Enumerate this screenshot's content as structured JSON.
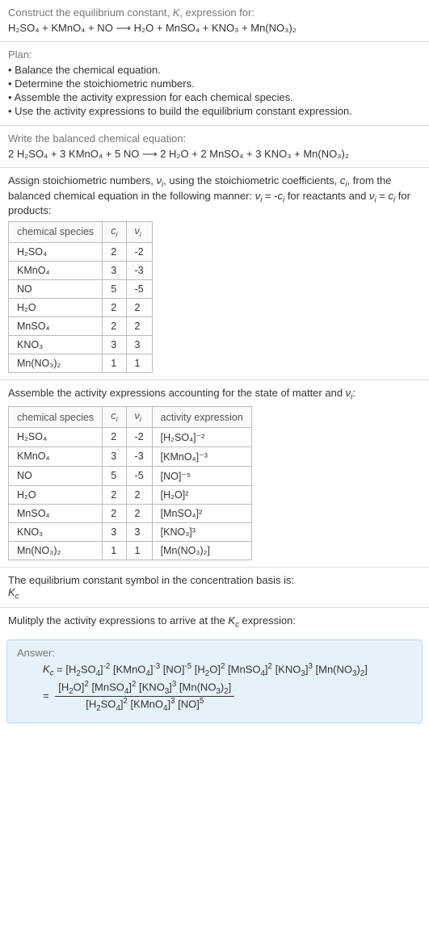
{
  "intro": {
    "line1": "Construct the equilibrium constant, K, expression for:",
    "equation": "H₂SO₄ + KMnO₄ + NO ⟶ H₂O + MnSO₄ + KNO₃ + Mn(NO₃)₂"
  },
  "plan": {
    "heading": "Plan:",
    "items": [
      "Balance the chemical equation.",
      "Determine the stoichiometric numbers.",
      "Assemble the activity expression for each chemical species.",
      "Use the activity expressions to build the equilibrium constant expression."
    ]
  },
  "balanced": {
    "heading": "Write the balanced chemical equation:",
    "equation": "2 H₂SO₄ + 3 KMnO₄ + 5 NO ⟶ 2 H₂O + 2 MnSO₄ + 3 KNO₃ + Mn(NO₃)₂"
  },
  "stoich": {
    "heading": "Assign stoichiometric numbers, νᵢ, using the stoichiometric coefficients, cᵢ, from the balanced chemical equation in the following manner: νᵢ = -cᵢ for reactants and νᵢ = cᵢ for products:",
    "headers": {
      "species": "chemical species",
      "c": "cᵢ",
      "v": "νᵢ"
    },
    "rows": [
      {
        "species": "H₂SO₄",
        "c": "2",
        "v": "-2"
      },
      {
        "species": "KMnO₄",
        "c": "3",
        "v": "-3"
      },
      {
        "species": "NO",
        "c": "5",
        "v": "-5"
      },
      {
        "species": "H₂O",
        "c": "2",
        "v": "2"
      },
      {
        "species": "MnSO₄",
        "c": "2",
        "v": "2"
      },
      {
        "species": "KNO₃",
        "c": "3",
        "v": "3"
      },
      {
        "species": "Mn(NO₃)₂",
        "c": "1",
        "v": "1"
      }
    ]
  },
  "activity": {
    "heading": "Assemble the activity expressions accounting for the state of matter and νᵢ:",
    "headers": {
      "species": "chemical species",
      "c": "cᵢ",
      "v": "νᵢ",
      "expr": "activity expression"
    },
    "rows": [
      {
        "species": "H₂SO₄",
        "c": "2",
        "v": "-2",
        "expr": "[H₂SO₄]⁻²"
      },
      {
        "species": "KMnO₄",
        "c": "3",
        "v": "-3",
        "expr": "[KMnO₄]⁻³"
      },
      {
        "species": "NO",
        "c": "5",
        "v": "-5",
        "expr": "[NO]⁻⁵"
      },
      {
        "species": "H₂O",
        "c": "2",
        "v": "2",
        "expr": "[H₂O]²"
      },
      {
        "species": "MnSO₄",
        "c": "2",
        "v": "2",
        "expr": "[MnSO₄]²"
      },
      {
        "species": "KNO₃",
        "c": "3",
        "v": "3",
        "expr": "[KNO₃]³"
      },
      {
        "species": "Mn(NO₃)₂",
        "c": "1",
        "v": "1",
        "expr": "[Mn(NO₃)₂]"
      }
    ]
  },
  "kc_symbol": {
    "line1": "The equilibrium constant symbol in the concentration basis is:",
    "line2": "K𝒸"
  },
  "multiply": {
    "heading": "Mulitply the activity expressions to arrive at the K𝒸 expression:"
  },
  "answer": {
    "label": "Answer:",
    "line1": "K𝒸 = [H₂SO₄]⁻² [KMnO₄]⁻³ [NO]⁻⁵ [H₂O]² [MnSO₄]² [KNO₃]³ [Mn(NO₃)₂]",
    "eq_prefix": "= ",
    "frac_num": "[H₂O]² [MnSO₄]² [KNO₃]³ [Mn(NO₃)₂]",
    "frac_den": "[H₂SO₄]² [KMnO₄]³ [NO]⁵"
  }
}
